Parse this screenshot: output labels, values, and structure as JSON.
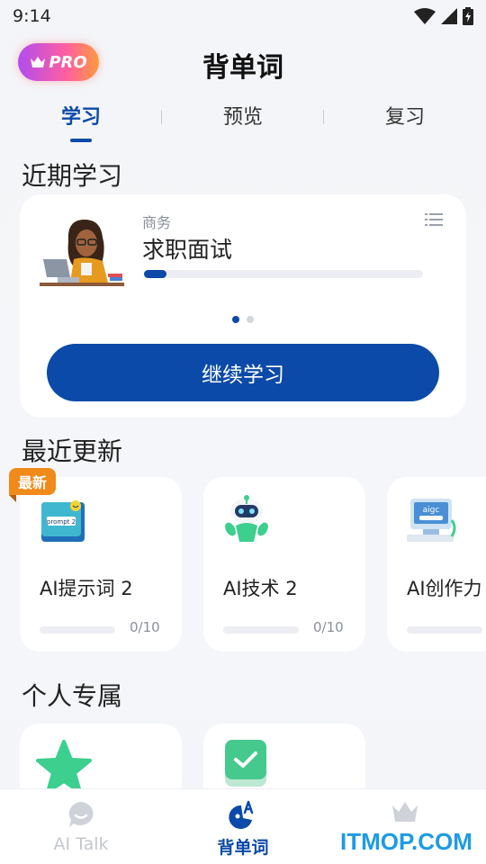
{
  "status_bar": {
    "time": "9:14"
  },
  "header": {
    "pro_label": "PRO",
    "title": "背单词"
  },
  "tabs": [
    {
      "label": "学习",
      "active": true
    },
    {
      "label": "预览",
      "active": false
    },
    {
      "label": "复习",
      "active": false
    }
  ],
  "recent": {
    "section_title": "近期学习",
    "category": "商务",
    "course_title": "求职面试",
    "progress": 0.08,
    "carousel_pages": 2,
    "carousel_active": 0,
    "continue_label": "继续学习"
  },
  "updates": {
    "section_title": "最近更新",
    "new_badge": "最新",
    "items": [
      {
        "title": "AI提示词 2",
        "count": "0/10",
        "icon": "prompt-book-icon"
      },
      {
        "title": "AI技术 2",
        "count": "0/10",
        "icon": "robot-icon"
      },
      {
        "title": "AI创作力",
        "count": "",
        "icon": "aigc-computer-icon"
      }
    ]
  },
  "personal": {
    "section_title": "个人专属",
    "items": [
      {
        "icon": "star-icon"
      },
      {
        "icon": "check-note-icon"
      }
    ]
  },
  "bottom_nav": [
    {
      "label": "AI Talk",
      "icon": "chat-bubble-icon",
      "active": false
    },
    {
      "label": "背单词",
      "icon": "vocab-icon",
      "active": true
    },
    {
      "label": "",
      "icon": "crown-icon",
      "active": false
    }
  ],
  "watermark": "ITMOP.COM",
  "colors": {
    "primary": "#0b4aa8",
    "badge_orange": "#f08a1a",
    "pro_gradient_start": "#b14cf0",
    "pro_gradient_end": "#ff9a3d",
    "star_green": "#3ccf8e"
  }
}
